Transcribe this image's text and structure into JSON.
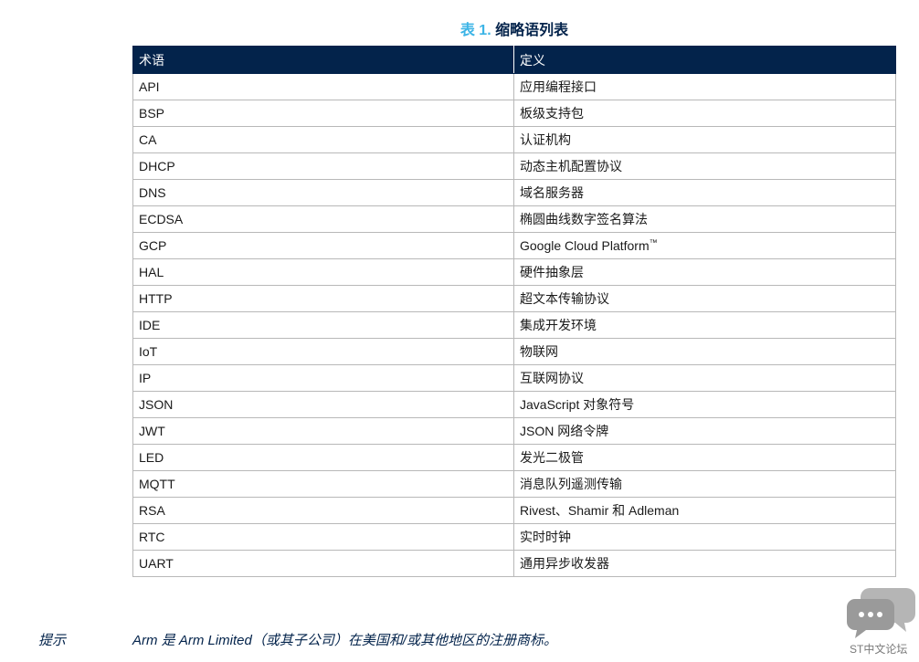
{
  "caption": {
    "number": "表 1.",
    "title": "缩略语列表"
  },
  "table": {
    "headers": [
      "术语",
      "定义"
    ],
    "rows": [
      {
        "term": "API",
        "definition": "应用编程接口"
      },
      {
        "term": "BSP",
        "definition": "板级支持包"
      },
      {
        "term": "CA",
        "definition": "认证机构"
      },
      {
        "term": "DHCP",
        "definition": "动态主机配置协议"
      },
      {
        "term": "DNS",
        "definition": "域名服务器"
      },
      {
        "term": "ECDSA",
        "definition": "椭圆曲线数字签名算法"
      },
      {
        "term": "GCP",
        "definition": "Google Cloud Platform",
        "sup": "™"
      },
      {
        "term": "HAL",
        "definition": "硬件抽象层"
      },
      {
        "term": "HTTP",
        "definition": "超文本传输协议"
      },
      {
        "term": "IDE",
        "definition": "集成开发环境"
      },
      {
        "term": "IoT",
        "definition": "物联网"
      },
      {
        "term": "IP",
        "definition": "互联网协议"
      },
      {
        "term": "JSON",
        "definition": "JavaScript 对象符号"
      },
      {
        "term": "JWT",
        "definition": "JSON 网络令牌"
      },
      {
        "term": "LED",
        "definition": "发光二极管"
      },
      {
        "term": "MQTT",
        "definition": "消息队列遥测传输"
      },
      {
        "term": "RSA",
        "definition": "Rivest、Shamir 和 Adleman"
      },
      {
        "term": "RTC",
        "definition": "实时时钟"
      },
      {
        "term": "UART",
        "definition": "通用异步收发器"
      }
    ]
  },
  "note": {
    "label": "提示",
    "text": "Arm 是 Arm Limited（或其子公司）在美国和/或其他地区的注册商标。"
  },
  "watermark": {
    "text": "ST中文论坛",
    "icon": "chat-bubbles-icon",
    "color": "#9a9a9a"
  }
}
